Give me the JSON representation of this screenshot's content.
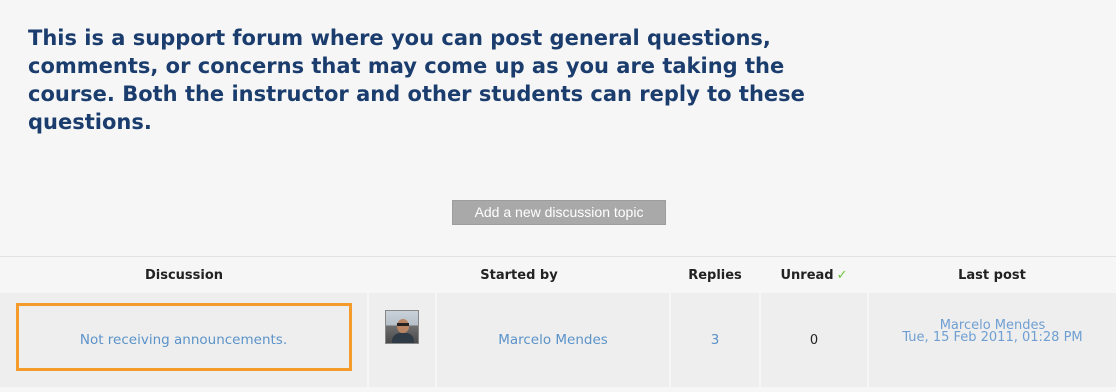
{
  "intro": {
    "text": "This is a support forum where you can post general questions, comments, or concerns that may come up as you are taking the course. Both the instructor and other students can reply to these questions."
  },
  "actions": {
    "add_topic_label": "Add a new discussion topic"
  },
  "table": {
    "headers": {
      "discussion": "Discussion",
      "started_by": "Started by",
      "replies": "Replies",
      "unread": "Unread",
      "last_post": "Last post"
    },
    "unread_icon": "checkmark-icon",
    "rows": [
      {
        "topic": "Not receiving announcements.",
        "avatar_icon": "user-avatar",
        "author": "Marcelo Mendes",
        "replies": "3",
        "unread": "0",
        "last_post_author": "Marcelo Mendes",
        "last_post_date": "Tue, 15 Feb 2011, 01:28 PM"
      }
    ]
  },
  "colors": {
    "heading": "#1b3d6e",
    "link": "#5b93c9",
    "highlight": "#f59b2b",
    "check": "#6ac23a",
    "button_bg": "#a9a9a9"
  }
}
